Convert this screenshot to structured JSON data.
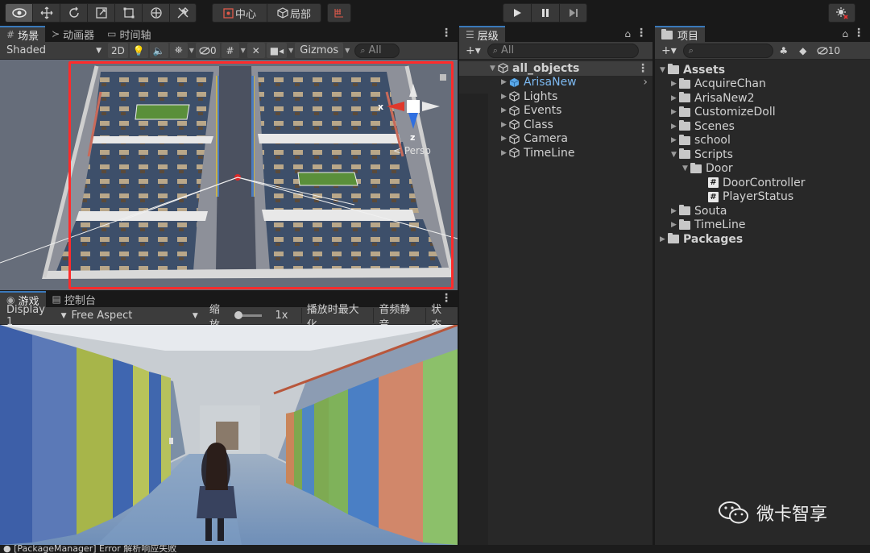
{
  "toolbar": {
    "pivot_label": "中心",
    "local_label": "局部"
  },
  "scene": {
    "tab_scene": "场景",
    "tab_animator": "动画器",
    "tab_timeline": "时间轴",
    "shading_mode": "Shaded",
    "btn_2d": "2D",
    "hidden_count": "0",
    "gizmos_label": "Gizmos",
    "search_placeholder": "All",
    "gizmo_x": "x",
    "gizmo_z": "z",
    "persp_label": "< Persp",
    "highlight_color": "#ff2b2b"
  },
  "game": {
    "tab_game": "游戏",
    "tab_console": "控制台",
    "display": "Display 1",
    "aspect": "Free Aspect",
    "scale_label": "缩放",
    "scale_value": "1x",
    "maximize_label": "播放时最大化",
    "mute_label": "音频静音",
    "stats_label": "状态"
  },
  "hierarchy": {
    "tab": "层级",
    "add": "+▾",
    "search_placeholder": "All",
    "root": "all_objects",
    "items": [
      "ArisaNew",
      "Lights",
      "Events",
      "Class",
      "Camera",
      "TimeLine"
    ]
  },
  "project": {
    "tab": "项目",
    "add": "+▾",
    "hidden_count": "10",
    "tree": {
      "assets": "Assets",
      "folders": [
        "AcquireChan",
        "ArisaNew2",
        "CustomizeDoll",
        "Scenes",
        "school"
      ],
      "scripts": "Scripts",
      "door": "Door",
      "door_scripts": [
        "DoorController",
        "PlayerStatus"
      ],
      "after": [
        "Souta",
        "TimeLine"
      ],
      "packages": "Packages"
    }
  },
  "watermark": "微卡智享",
  "status_text": "[PackageManager] Error 解析响应失败"
}
